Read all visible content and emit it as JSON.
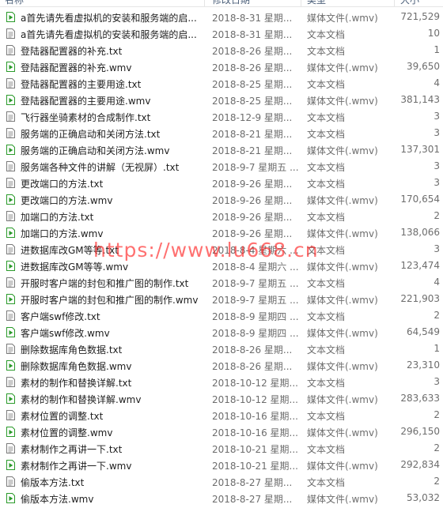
{
  "columns": {
    "name": "名称",
    "date": "修改日期",
    "type": "类型",
    "size": "大小"
  },
  "watermark": "https://www.lu668.cn",
  "colors": {
    "video_icon": "#2a9a2a",
    "text_icon": "#7a7a7a",
    "watermark": "#ff1a1a"
  },
  "files": [
    {
      "kind": "video",
      "name": "a首先请先看虚拟机的安装和服务端的启...",
      "date": "2018-8-31 星期...",
      "type": "媒体文件(.wmv)",
      "size": "721,529"
    },
    {
      "kind": "text",
      "name": "a首先请先看虚拟机的安装和服务端的启...",
      "date": "2018-8-31 星期...",
      "type": "文本文档",
      "size": "10"
    },
    {
      "kind": "text",
      "name": "登陆器配置器的补充.txt",
      "date": "2018-8-26 星期...",
      "type": "文本文档",
      "size": "1"
    },
    {
      "kind": "video",
      "name": "登陆器配置器的补充.wmv",
      "date": "2018-8-26 星期...",
      "type": "媒体文件(.wmv)",
      "size": "39,650"
    },
    {
      "kind": "text",
      "name": "登陆器配置器的主要用途.txt",
      "date": "2018-8-25 星期...",
      "type": "文本文档",
      "size": "4"
    },
    {
      "kind": "video",
      "name": "登陆器配置器的主要用途.wmv",
      "date": "2018-8-25 星期...",
      "type": "媒体文件(.wmv)",
      "size": "381,143"
    },
    {
      "kind": "text",
      "name": "飞行器坐骑素材的合成制作.txt",
      "date": "2018-12-9 星期...",
      "type": "文本文档",
      "size": "3"
    },
    {
      "kind": "text",
      "name": "服务端的正确启动和关闭方法.txt",
      "date": "2018-8-21 星期...",
      "type": "文本文档",
      "size": "3"
    },
    {
      "kind": "video",
      "name": "服务端的正确启动和关闭方法.wmv",
      "date": "2018-8-21 星期...",
      "type": "媒体文件(.wmv)",
      "size": "137,301"
    },
    {
      "kind": "text",
      "name": "服务端各种文件的讲解（无视屏）.txt",
      "date": "2018-9-7 星期五 ...",
      "type": "文本文档",
      "size": "3"
    },
    {
      "kind": "text",
      "name": "更改端口的方法.txt",
      "date": "2018-9-26 星期...",
      "type": "文本文档",
      "size": "3"
    },
    {
      "kind": "video",
      "name": "更改端口的方法.wmv",
      "date": "2018-9-26 星期...",
      "type": "媒体文件(.wmv)",
      "size": "170,654"
    },
    {
      "kind": "text",
      "name": "加端口的方法.txt",
      "date": "2018-9-26 星期...",
      "type": "文本文档",
      "size": "2"
    },
    {
      "kind": "video",
      "name": "加端口的方法.wmv",
      "date": "2018-9-26 星期...",
      "type": "媒体文件(.wmv)",
      "size": "138,066"
    },
    {
      "kind": "text",
      "name": "进数据库改GM等等.txt",
      "date": "2018-8-4 星期六 ...",
      "type": "文本文档",
      "size": "3"
    },
    {
      "kind": "video",
      "name": "进数据库改GM等等.wmv",
      "date": "2018-8-4 星期六 ...",
      "type": "媒体文件(.wmv)",
      "size": "123,474"
    },
    {
      "kind": "text",
      "name": "开服时客户端的封包和推广图的制作.txt",
      "date": "2018-9-7 星期五 ...",
      "type": "文本文档",
      "size": "4"
    },
    {
      "kind": "video",
      "name": "开服时客户端的封包和推广图的制作.wmv",
      "date": "2018-9-7 星期五 ...",
      "type": "媒体文件(.wmv)",
      "size": "221,903"
    },
    {
      "kind": "text",
      "name": "客户端swf修改.txt",
      "date": "2018-8-9 星期四 ...",
      "type": "文本文档",
      "size": "2"
    },
    {
      "kind": "video",
      "name": "客户端swf修改.wmv",
      "date": "2018-8-9 星期四 ...",
      "type": "媒体文件(.wmv)",
      "size": "64,549"
    },
    {
      "kind": "text",
      "name": "删除数据库角色数据.txt",
      "date": "2018-8-26 星期...",
      "type": "文本文档",
      "size": "1"
    },
    {
      "kind": "video",
      "name": "删除数据库角色数据.wmv",
      "date": "2018-8-26 星期...",
      "type": "媒体文件(.wmv)",
      "size": "23,310"
    },
    {
      "kind": "text",
      "name": "素材的制作和替换详解.txt",
      "date": "2018-10-12 星期...",
      "type": "文本文档",
      "size": "3"
    },
    {
      "kind": "video",
      "name": "素材的制作和替换详解.wmv",
      "date": "2018-10-12 星期...",
      "type": "媒体文件(.wmv)",
      "size": "283,633"
    },
    {
      "kind": "text",
      "name": "素材位置的调整.txt",
      "date": "2018-10-16 星期...",
      "type": "文本文档",
      "size": "2"
    },
    {
      "kind": "video",
      "name": "素材位置的调整.wmv",
      "date": "2018-10-16 星期...",
      "type": "媒体文件(.wmv)",
      "size": "296,150"
    },
    {
      "kind": "text",
      "name": "素材制作之再讲一下.txt",
      "date": "2018-10-21 星期...",
      "type": "文本文档",
      "size": "2"
    },
    {
      "kind": "video",
      "name": "素材制作之再讲一下.wmv",
      "date": "2018-10-21 星期...",
      "type": "媒体文件(.wmv)",
      "size": "292,834"
    },
    {
      "kind": "text",
      "name": "偷版本方法.txt",
      "date": "2018-8-27 星期...",
      "type": "文本文档",
      "size": "2"
    },
    {
      "kind": "video",
      "name": "偷版本方法.wmv",
      "date": "2018-8-27 星期...",
      "type": "媒体文件(.wmv)",
      "size": "53,032"
    }
  ]
}
